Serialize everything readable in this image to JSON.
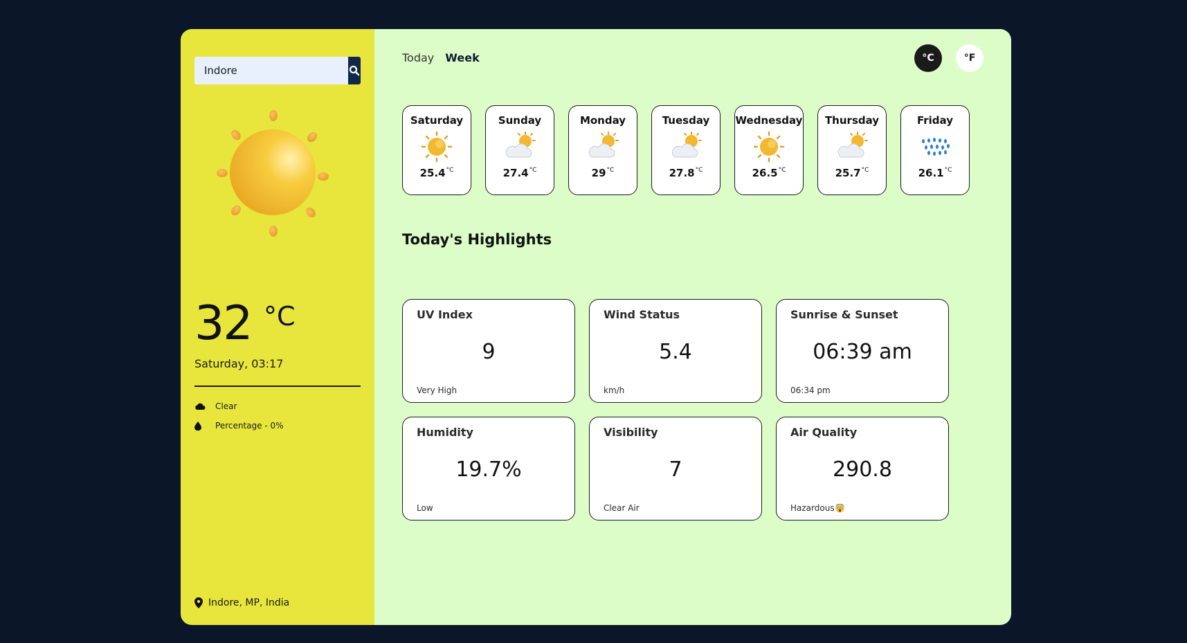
{
  "search": {
    "value": "Indore",
    "icon": "search-icon"
  },
  "current": {
    "temperature": "32",
    "unit": "°C",
    "datetime": "Saturday, 03:17",
    "condition": "Clear",
    "precipitation": "Percentage - 0%",
    "location": "Indore, MP, India"
  },
  "tabs": [
    {
      "label": "Today"
    },
    {
      "label": "Week"
    }
  ],
  "units": {
    "celsius": "°C",
    "fahrenheit": "°F"
  },
  "forecast": [
    {
      "day": "Saturday",
      "temp": "25.4",
      "unit": "°C",
      "icon": "sun-icon"
    },
    {
      "day": "Sunday",
      "temp": "27.4",
      "unit": "°C",
      "icon": "partly-cloudy-icon"
    },
    {
      "day": "Monday",
      "temp": "29",
      "unit": "°C",
      "icon": "partly-cloudy-icon"
    },
    {
      "day": "Tuesday",
      "temp": "27.8",
      "unit": "°C",
      "icon": "partly-cloudy-icon"
    },
    {
      "day": "Wednesday",
      "temp": "26.5",
      "unit": "°C",
      "icon": "sun-icon"
    },
    {
      "day": "Thursday",
      "temp": "25.7",
      "unit": "°C",
      "icon": "partly-cloudy-icon"
    },
    {
      "day": "Friday",
      "temp": "26.1",
      "unit": "°C",
      "icon": "rain-icon"
    }
  ],
  "highlights": {
    "title": "Today's Highlights",
    "cards": [
      {
        "title": "UV Index",
        "value": "9",
        "sub": "Very High"
      },
      {
        "title": "Wind Status",
        "value": "5.4",
        "sub": "km/h"
      },
      {
        "title": "Sunrise & Sunset",
        "value": "06:39 am",
        "sub": "06:34 pm"
      },
      {
        "title": "Humidity",
        "value": "19.7%",
        "sub": "Low"
      },
      {
        "title": "Visibility",
        "value": "7",
        "sub": "Clear Air"
      },
      {
        "title": "Air Quality",
        "value": "290.8",
        "sub": "Hazardous",
        "sub_icon": "scared-face-icon"
      }
    ]
  },
  "colors": {
    "page_bg": "#0b1628",
    "sidebar_bg": "#e8e63c",
    "main_bg": "#dcfdc8",
    "search_button": "#12284a"
  }
}
